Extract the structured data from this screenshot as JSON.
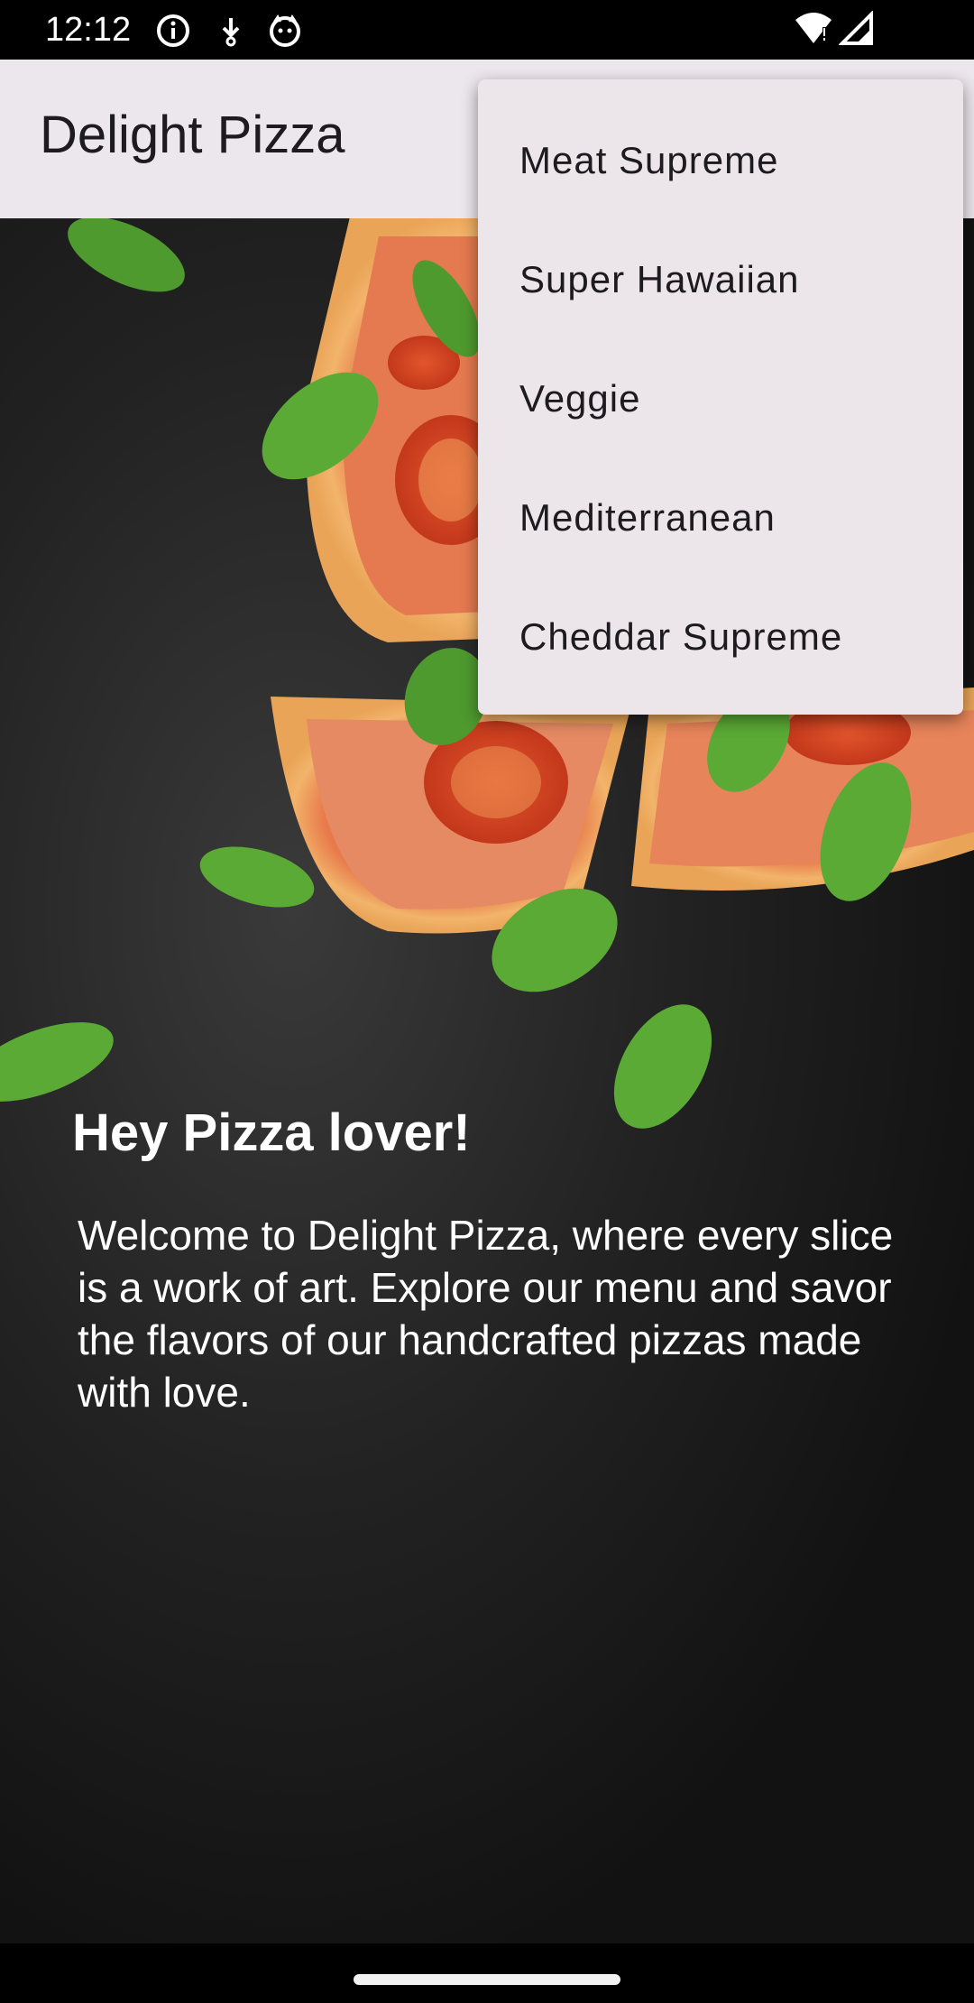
{
  "status_bar": {
    "time": "12:12",
    "icons": [
      "info-icon",
      "download-icon",
      "cat-icon",
      "wifi-icon",
      "signal-icon"
    ]
  },
  "app_bar": {
    "title": "Delight Pizza"
  },
  "menu": {
    "items": [
      "Meat Supreme",
      "Super Hawaiian",
      "Veggie",
      "Mediterranean",
      "Cheddar Supreme"
    ]
  },
  "hero": {
    "title": "Hey Pizza lover!",
    "body": "Welcome to Delight Pizza, where every slice is a work of art. Explore our menu and savor the flavors of our handcrafted pizzas made with love."
  },
  "colors": {
    "app_bar_bg": "#ECE7EC",
    "menu_bg": "#ECE6EB",
    "text_dark": "#1D1B20",
    "background": "#121212"
  }
}
